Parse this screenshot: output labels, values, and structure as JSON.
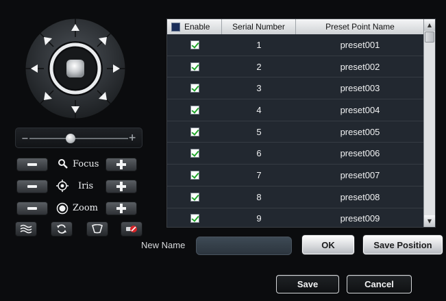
{
  "ptz": {
    "speed_value": 0.42,
    "focus_label": "Focus",
    "iris_label": "Iris",
    "zoom_label": "Zoom"
  },
  "table": {
    "headers": {
      "enable": "Enable",
      "serial": "Serial Number",
      "name": "Preset Point Name"
    },
    "rows": [
      {
        "enabled": true,
        "serial": "1",
        "name": "preset001"
      },
      {
        "enabled": true,
        "serial": "2",
        "name": "preset002"
      },
      {
        "enabled": true,
        "serial": "3",
        "name": "preset003"
      },
      {
        "enabled": true,
        "serial": "4",
        "name": "preset004"
      },
      {
        "enabled": true,
        "serial": "5",
        "name": "preset005"
      },
      {
        "enabled": true,
        "serial": "6",
        "name": "preset006"
      },
      {
        "enabled": true,
        "serial": "7",
        "name": "preset007"
      },
      {
        "enabled": true,
        "serial": "8",
        "name": "preset008"
      },
      {
        "enabled": true,
        "serial": "9",
        "name": "preset009"
      }
    ]
  },
  "new_name": {
    "label": "New Name",
    "value": ""
  },
  "buttons": {
    "ok": "OK",
    "save_position": "Save Position",
    "save": "Save",
    "cancel": "Cancel"
  },
  "icons": {
    "wiper": "wiper-icon",
    "auto_scan": "auto-scan-icon",
    "light": "light-icon",
    "stop_cruise": "stop-cruise-icon",
    "focus": "focus-icon",
    "iris": "iris-icon",
    "zoom": "zoom-icon"
  },
  "colors": {
    "background": "#0b0c0e",
    "table_bg": "#222830",
    "check_green": "#1fa52a"
  }
}
